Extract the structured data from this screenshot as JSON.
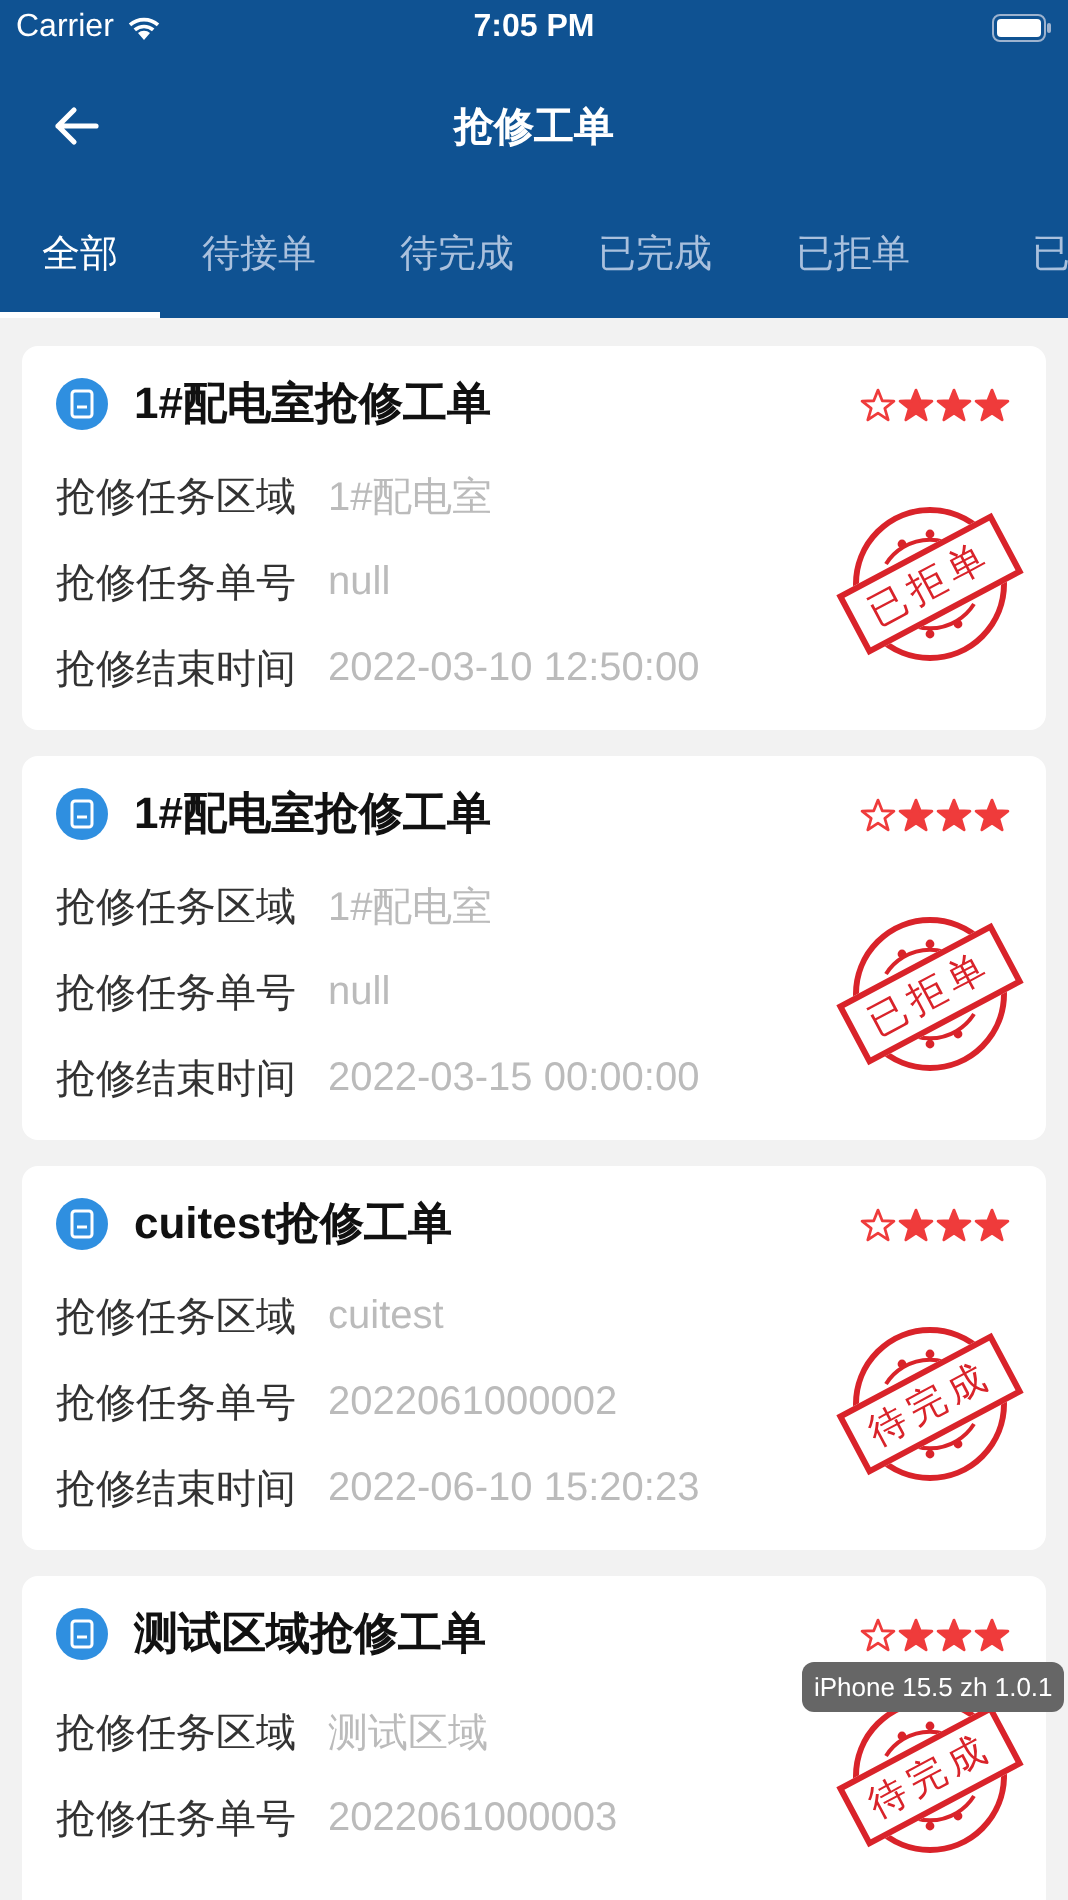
{
  "status_bar": {
    "carrier": "Carrier",
    "time": "7:05 PM"
  },
  "nav": {
    "title": "抢修工单"
  },
  "tabs": [
    {
      "label": "全部",
      "selected": true
    },
    {
      "label": "待接单",
      "selected": false
    },
    {
      "label": "待完成",
      "selected": false
    },
    {
      "label": "已完成",
      "selected": false
    },
    {
      "label": "已拒单",
      "selected": false
    },
    {
      "label": "已",
      "selected": false
    }
  ],
  "orders": [
    {
      "title": "1#配电室抢修工单",
      "stars": 3,
      "stamp": "已拒单",
      "fields": [
        {
          "label": "抢修任务区域",
          "value": "1#配电室"
        },
        {
          "label": "抢修任务单号",
          "value": "null"
        },
        {
          "label": "抢修结束时间",
          "value": "2022-03-10 12:50:00"
        }
      ]
    },
    {
      "title": "1#配电室抢修工单",
      "stars": 3,
      "stamp": "已拒单",
      "fields": [
        {
          "label": "抢修任务区域",
          "value": "1#配电室"
        },
        {
          "label": "抢修任务单号",
          "value": "null"
        },
        {
          "label": "抢修结束时间",
          "value": "2022-03-15 00:00:00"
        }
      ]
    },
    {
      "title": "cuitest抢修工单",
      "stars": 3,
      "stamp": "待完成",
      "fields": [
        {
          "label": "抢修任务区域",
          "value": "cuitest"
        },
        {
          "label": "抢修任务单号",
          "value": "2022061000002"
        },
        {
          "label": "抢修结束时间",
          "value": "2022-06-10 15:20:23"
        }
      ]
    },
    {
      "title": "测试区域抢修工单",
      "stars": 3,
      "stamp": "待完成",
      "fields": [
        {
          "label": "抢修任务区域",
          "value": "测试区域"
        },
        {
          "label": "抢修任务单号",
          "value": "2022061000003"
        }
      ]
    }
  ],
  "tooltip": "iPhone 15.5 zh 1.0.1"
}
